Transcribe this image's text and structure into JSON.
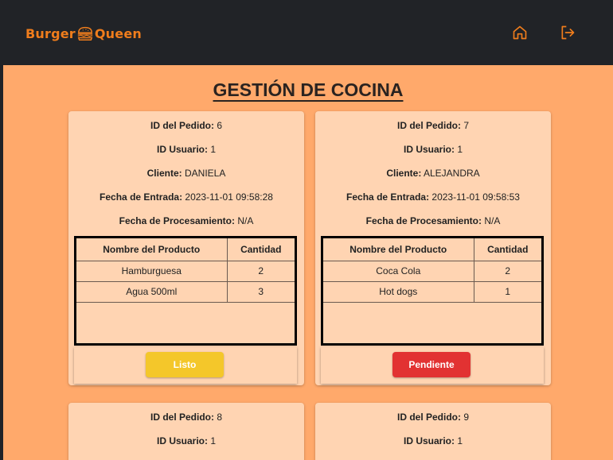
{
  "colors": {
    "brand": "#f07d1c",
    "navbar": "#212327",
    "page_bg": "#ffa96b",
    "card_bg": "#ffd4b2",
    "ready": "#f4c72a",
    "pending": "#e23232"
  },
  "brand": {
    "part1": "Burger",
    "part2": "Queen"
  },
  "nav": {
    "icons": [
      "home-icon",
      "logout-icon"
    ]
  },
  "page": {
    "title": "GESTIÓN DE COCINA"
  },
  "labels": {
    "order_id": "ID del Pedido:",
    "user_id": "ID Usuario:",
    "client": "Cliente:",
    "entry_date": "Fecha de Entrada:",
    "processing_date": "Fecha de Procesamiento:",
    "col_product": "Nombre del Producto",
    "col_qty": "Cantidad"
  },
  "orders": [
    {
      "id": " 6",
      "user_id": " 1",
      "client": " DANIELA",
      "entry_date": " 2023-11-01 09:58:28",
      "processing_date": " N/A",
      "products": [
        {
          "name": "Hamburguesa",
          "qty": "2"
        },
        {
          "name": "Agua 500ml",
          "qty": "3"
        }
      ],
      "status": "Listo"
    },
    {
      "id": " 7",
      "user_id": " 1",
      "client": " ALEJANDRA",
      "entry_date": " 2023-11-01 09:58:53",
      "processing_date": " N/A",
      "products": [
        {
          "name": "Coca Cola",
          "qty": "2"
        },
        {
          "name": "Hot dogs",
          "qty": "1"
        }
      ],
      "status": "Pendiente"
    },
    {
      "id": " 8",
      "user_id": " 1"
    },
    {
      "id": " 9",
      "user_id": " 1"
    }
  ]
}
